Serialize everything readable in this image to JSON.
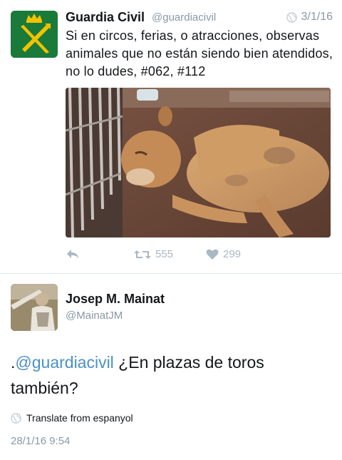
{
  "tweet1": {
    "author_name": "Guardia Civil",
    "author_handle": "@guardiacivil",
    "date": "3/1/16",
    "text": "Si en circos, ferias, o atracciones, observas animales que no están siendo bien atendidos, no lo dudes, #062, #112",
    "retweets": "555",
    "likes": "299",
    "avatar_icon": "guardia-civil-crest-icon",
    "avatar_color": "#1a7a3a"
  },
  "tweet2": {
    "author_name": "Josep M. Mainat",
    "author_handle": "@MainatJM",
    "prefix": ".",
    "mention": "@guardiacivil",
    "text": " ¿En plazas de toros también?",
    "translate_label": "Translate from espanyol",
    "timestamp": "28/1/16 9:54"
  },
  "colors": {
    "accent": "#4a90c8",
    "muted": "#8899a6",
    "icon_muted": "#aab8c2"
  }
}
